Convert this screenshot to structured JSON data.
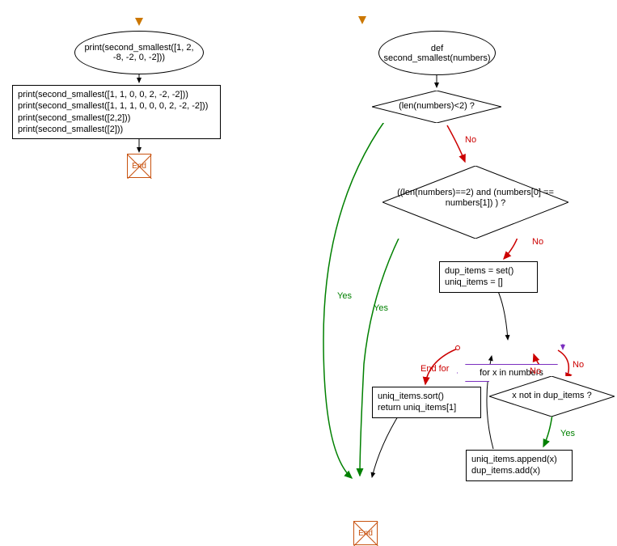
{
  "left": {
    "start": "print(second_smallest([1, 2, -8, -2, 0, -2]))",
    "printsLine1": "print(second_smallest([1, 1, 0, 0, 2, -2, -2]))",
    "printsLine2": "print(second_smallest([1, 1, 1, 0, 0, 0, 2, -2, -2]))",
    "printsLine3": "print(second_smallest([2,2]))",
    "printsLine4": "print(second_smallest([2]))",
    "end": "End"
  },
  "right": {
    "def": "def second_smallest(numbers)",
    "cond1": "(len(numbers)<2) ?",
    "cond2": "((len(numbers)==2) and (numbers[0] == numbers[1]) ) ?",
    "initLine1": "dup_items = set()",
    "initLine2": "uniq_items = []",
    "loop": "for x in numbers",
    "cond3": "x not in dup_items ?",
    "appendLine1": "uniq_items.append(x)",
    "appendLine2": "dup_items.add(x)",
    "sortLine1": "uniq_items.sort()",
    "sortLine2": "return  uniq_items[1]",
    "end": "End"
  },
  "labels": {
    "yes": "Yes",
    "no": "No",
    "endfor": "End for"
  }
}
